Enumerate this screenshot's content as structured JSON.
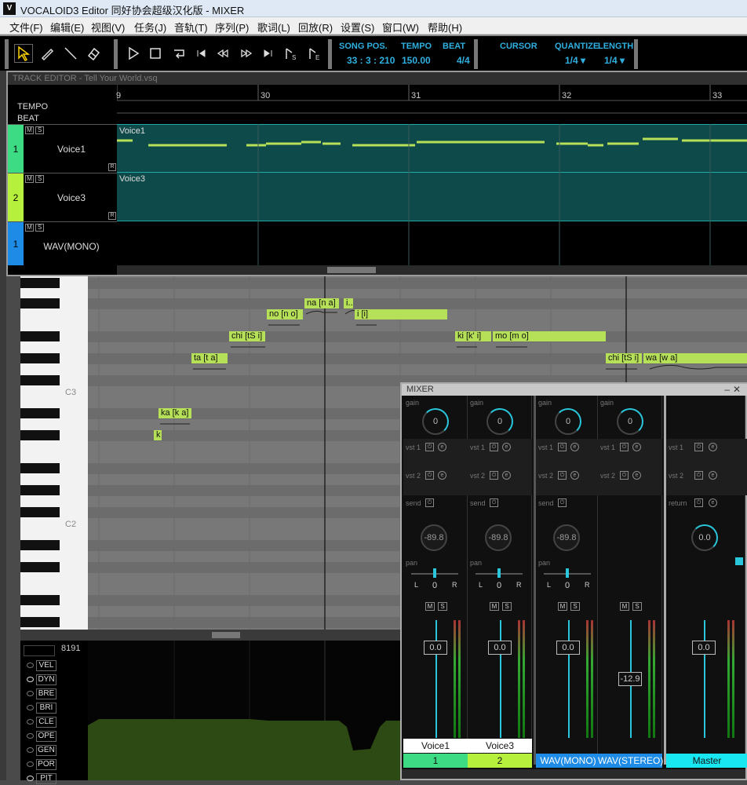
{
  "window": {
    "title": "VOCALOID3 Editor 同好协会超级汉化版 - MIXER",
    "icon": "V"
  },
  "menu": [
    "文件(F)",
    "编辑(E)",
    "视图(V)",
    "任务(J)",
    "音轨(T)",
    "序列(P)",
    "歌词(L)",
    "回放(R)",
    "设置(S)",
    "窗口(W)",
    "帮助(H)"
  ],
  "transport": {
    "song_pos_label": "SONG POS.",
    "song_pos": "33 : 3 : 210",
    "tempo_label": "TEMPO",
    "tempo": "150.00",
    "beat_label": "BEAT",
    "beat": "4/4",
    "cursor_label": "CURSOR",
    "quantize_label": "QUANTIZE",
    "quantize": "1/4 ▾",
    "length_label": "LENGTH",
    "length": "1/4 ▾"
  },
  "track_editor": {
    "title": "TRACK EDITOR - Tell Your World.vsq",
    "tempo_label": "TEMPO",
    "beat_label": "BEAT",
    "measures": [
      "9",
      "30",
      "31",
      "32",
      "33"
    ],
    "tracks": [
      {
        "num": "1",
        "name": "Voice1",
        "part": "Voice1",
        "color": "#3ddc84"
      },
      {
        "num": "2",
        "name": "Voice3",
        "part": "Voice3",
        "color": "#b7f03c"
      },
      {
        "num": "1",
        "name": "WAV(MONO)",
        "part": "",
        "color": "#1e8ce6"
      }
    ]
  },
  "piano_roll": {
    "key_labels": [
      "C3",
      "C2"
    ],
    "notes": [
      "na [n a]",
      "i..",
      "no [n o]",
      "i [i]",
      "chi [tS i]",
      "ki [k' i]",
      "mo [m o]",
      "ta [t a]",
      "chi [tS i]",
      "wa [w a]",
      "ka [k a]",
      "k"
    ]
  },
  "control_track": {
    "max_value": "8191",
    "controls": [
      "VEL",
      "DYN",
      "BRE",
      "BRI",
      "CLE",
      "OPE",
      "GEN",
      "POR",
      "PIT"
    ]
  },
  "mixer": {
    "title": "MIXER",
    "labels": {
      "gain": "gain",
      "vst1": "vst 1",
      "vst2": "vst 2",
      "send": "send",
      "return": "return",
      "pan": "pan",
      "l": "L",
      "r": "R",
      "m": "M",
      "s": "S"
    },
    "channels": [
      {
        "name": "Voice1",
        "num": "1",
        "gain": "0",
        "send": "-89.8",
        "pan": "0",
        "fader": "0.0",
        "color": "#3ddc84"
      },
      {
        "name": "Voice3",
        "num": "2",
        "gain": "0",
        "send": "-89.8",
        "pan": "0",
        "fader": "0.0",
        "color": "#b7f03c"
      },
      {
        "name": "WAV(MONO)",
        "num": "",
        "gain": "0",
        "send": "-89.8",
        "pan": "0",
        "fader": "0.0",
        "color": "#1e8ce6"
      },
      {
        "name": "WAV(STEREO)",
        "num": "",
        "gain": "0",
        "send": "",
        "pan": "",
        "fader": "-12.9",
        "color": "#1e8ce6"
      },
      {
        "name": "Master",
        "num": "",
        "gain": "",
        "send": "0.0",
        "pan": "",
        "fader": "0.0",
        "color": "#18e6f0"
      }
    ]
  }
}
